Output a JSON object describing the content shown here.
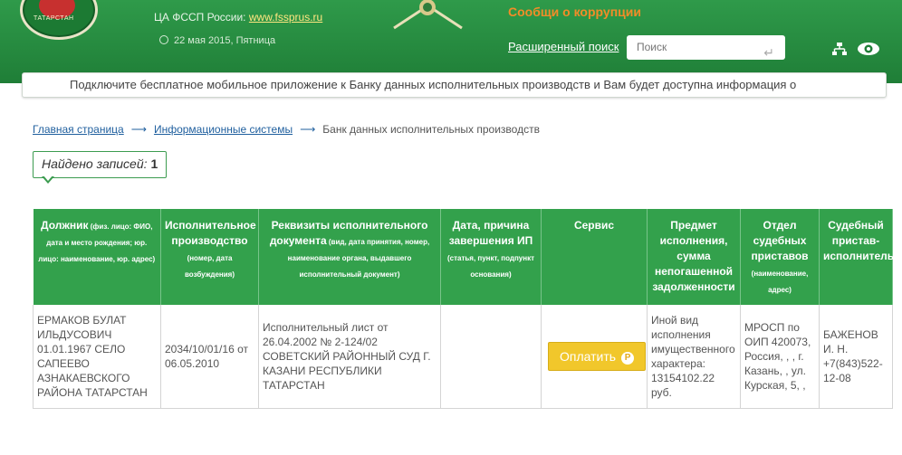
{
  "header": {
    "logo_text": "ТАТАРСТАН",
    "fssp_label": "ЦА ФССП России:",
    "fssp_link": "www.fssprus.ru",
    "date": "22 мая 2015, Пятница",
    "corruption": "Сообщи о коррупции",
    "advanced_search": "Расширенный поиск",
    "search_placeholder": "Поиск",
    "accent_color": "#2f9a4a"
  },
  "banner": {
    "text": "Подключите бесплатное мобильное приложение к Банку данных исполнительных производств и Вам будет доступна информация о"
  },
  "breadcrumb": {
    "home": "Главная страница",
    "systems": "Информационные системы",
    "current": "Банк данных исполнительных производств"
  },
  "found": {
    "label": "Найдено записей:",
    "count": "1"
  },
  "table": {
    "headers": [
      {
        "title": "Должник",
        "note": " (физ. лицо: ФИО, дата и место рождения; юр. лицо: наименование, юр. адрес)"
      },
      {
        "title": "Исполнительное производство",
        "note": " (номер, дата возбуждения)"
      },
      {
        "title": "Реквизиты исполнительного документа",
        "note": " (вид, дата принятия, номер, наименование органа, выдавшего исполнительный документ)"
      },
      {
        "title": "Дата, причина завершения ИП",
        "note": " (статья, пункт, подпункт основания)"
      },
      {
        "title": "Сервис",
        "note": ""
      },
      {
        "title": "Предмет исполнения, сумма непогашенной задолженности",
        "note": ""
      },
      {
        "title": "Отдел судебных приставов",
        "note": " (наименование, адрес)"
      },
      {
        "title": "Судебный пристав-исполнитель",
        "note": ""
      }
    ],
    "row": {
      "debtor": "ЕРМАКОВ БУЛАТ ИЛЬДУСОВИЧ 01.01.1967 СЕЛО САПЕЕВО АЗНАКАЕВСКОГО РАЙОНА ТАТАРСТАН",
      "proceeding": "2034/10/01/16 от 06.05.2010",
      "document": "Исполнительный лист от 26.04.2002 № 2-124/02 СОВЕТСКИЙ РАЙОННЫЙ СУД Г. КАЗАНИ РЕСПУБЛИКИ ТАТАРСТАН",
      "end": "",
      "pay_label": "Оплатить",
      "pay_symbol": "Р",
      "subject": "Иной вид исполнения имущественного характера: 13154102.22 руб.",
      "department": "МРОСП по ОИП 420073, Россия, , , г. Казань, , ул. Курская, 5, ,",
      "bailiff": "БАЖЕНОВ И. Н. +7(843)522-12-08"
    }
  }
}
